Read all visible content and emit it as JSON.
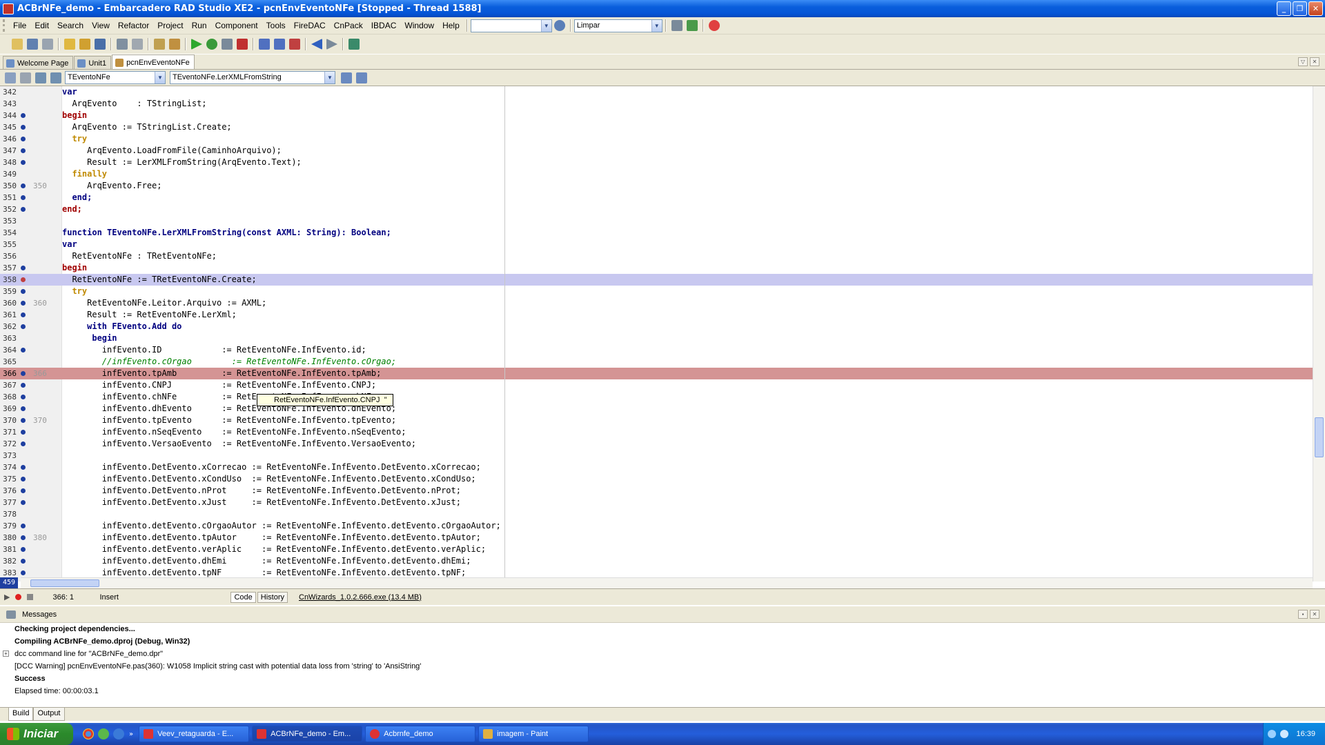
{
  "window": {
    "title": "ACBrNFe_demo - Embarcadero RAD Studio XE2 - pcnEnvEventoNFe [Stopped - Thread 1588]"
  },
  "menu": [
    "File",
    "Edit",
    "Search",
    "View",
    "Refactor",
    "Project",
    "Run",
    "Component",
    "Tools",
    "FireDAC",
    "CnPack",
    "IBDAC",
    "Window",
    "Help"
  ],
  "toolbar": {
    "layout_combo": "",
    "desktop_combo": "Limpar"
  },
  "tabs": [
    "Welcome Page",
    "Unit1",
    "pcnEnvEventoNFe"
  ],
  "navbar": {
    "class_combo": "TEventoNFe",
    "method_combo": "TEventoNFe.LerXMLFromString"
  },
  "editor": {
    "lines": [
      {
        "n": "342",
        "t": "var"
      },
      {
        "n": "343",
        "t": "  ArqEvento    : TStringList;"
      },
      {
        "n": "344",
        "t": "begin"
      },
      {
        "n": "345",
        "t": "  ArqEvento := TStringList.Create;"
      },
      {
        "n": "346",
        "t": "  try"
      },
      {
        "n": "347",
        "t": "     ArqEvento.LoadFromFile(CaminhoArquivo);"
      },
      {
        "n": "348",
        "t": "     Result := LerXMLFromString(ArqEvento.Text);"
      },
      {
        "n": "349",
        "t": "  finally"
      },
      {
        "n": "350",
        "t": "     ArqEvento.Free;"
      },
      {
        "n": "351",
        "t": "  end;"
      },
      {
        "n": "352",
        "t": "end;"
      },
      {
        "n": "353",
        "t": ""
      },
      {
        "n": "354",
        "t": "function TEventoNFe.LerXMLFromString(const AXML: String): Boolean;"
      },
      {
        "n": "355",
        "t": "var"
      },
      {
        "n": "356",
        "t": "  RetEventoNFe : TRetEventoNFe;"
      },
      {
        "n": "357",
        "t": "begin"
      },
      {
        "n": "358",
        "t": "  RetEventoNFe := TRetEventoNFe.Create;"
      },
      {
        "n": "359",
        "t": "  try"
      },
      {
        "n": "360",
        "t": "     RetEventoNFe.Leitor.Arquivo := AXML;"
      },
      {
        "n": "361",
        "t": "     Result := RetEventoNFe.LerXml;"
      },
      {
        "n": "362",
        "t": "     with FEvento.Add do"
      },
      {
        "n": "363",
        "t": "      begin"
      },
      {
        "n": "364",
        "t": "        infEvento.ID            := RetEventoNFe.InfEvento.id;"
      },
      {
        "n": "365",
        "t": "        //infEvento.cOrgao        := RetEventoNFe.InfEvento.cOrgao;"
      },
      {
        "n": "366",
        "t": "        infEvento.tpAmb         := RetEventoNFe.InfEvento.tpAmb;"
      },
      {
        "n": "367",
        "t": "        infEvento.CNPJ          := RetEventoNFe.InfEvento.CNPJ;"
      },
      {
        "n": "368",
        "t": "        infEvento.chNFe         := RetEventoNFe.InfEvento.chNFe;"
      },
      {
        "n": "369",
        "t": "        infEvento.dhEvento      := RetEventoNFe.InfEvento.dhEvento;"
      },
      {
        "n": "370",
        "t": "        infEvento.tpEvento      := RetEventoNFe.InfEvento.tpEvento;"
      },
      {
        "n": "371",
        "t": "        infEvento.nSeqEvento    := RetEventoNFe.InfEvento.nSeqEvento;"
      },
      {
        "n": "372",
        "t": "        infEvento.VersaoEvento  := RetEventoNFe.InfEvento.VersaoEvento;"
      },
      {
        "n": "373",
        "t": ""
      },
      {
        "n": "374",
        "t": "        infEvento.DetEvento.xCorrecao := RetEventoNFe.InfEvento.DetEvento.xCorrecao;"
      },
      {
        "n": "375",
        "t": "        infEvento.DetEvento.xCondUso  := RetEventoNFe.InfEvento.DetEvento.xCondUso;"
      },
      {
        "n": "376",
        "t": "        infEvento.DetEvento.nProt     := RetEventoNFe.InfEvento.DetEvento.nProt;"
      },
      {
        "n": "377",
        "t": "        infEvento.DetEvento.xJust     := RetEventoNFe.InfEvento.DetEvento.xJust;"
      },
      {
        "n": "378",
        "t": ""
      },
      {
        "n": "379",
        "t": "        infEvento.detEvento.cOrgaoAutor := RetEventoNFe.InfEvento.detEvento.cOrgaoAutor;"
      },
      {
        "n": "380",
        "t": "        infEvento.detEvento.tpAutor     := RetEventoNFe.InfEvento.detEvento.tpAutor;"
      },
      {
        "n": "381",
        "t": "        infEvento.detEvento.verAplic    := RetEventoNFe.InfEvento.detEvento.verAplic;"
      },
      {
        "n": "382",
        "t": "        infEvento.detEvento.dhEmi       := RetEventoNFe.InfEvento.detEvento.dhEmi;"
      },
      {
        "n": "383",
        "t": "        infEvento.detEvento.tpNF        := RetEventoNFe.InfEvento.detEvento.tpNF;"
      }
    ],
    "tooltip": "RetEventoNFe.InfEvento.CNPJ  ''",
    "line_count_label": "459"
  },
  "status": {
    "position": "366:  1",
    "mode": "Insert",
    "tab_code": "Code",
    "tab_history": "History",
    "cnwizards": "CnWizards_1.0.2.666.exe (13.4 MB)"
  },
  "messages": {
    "title": "Messages",
    "lines": [
      "Checking project dependencies...",
      "Compiling ACBrNFe_demo.dproj (Debug, Win32)",
      "dcc command line for \"ACBrNFe_demo.dpr\"",
      "[DCC Warning] pcnEnvEventoNFe.pas(360): W1058 Implicit string cast with potential data loss from 'string' to 'AnsiString'",
      "Success",
      "Elapsed time: 00:00:03.1"
    ],
    "tab_build": "Build",
    "tab_output": "Output"
  },
  "taskbar": {
    "start": "Iniciar",
    "buttons": [
      "Veev_retaguarda - E...",
      "ACBrNFe_demo - Em...",
      "Acbrnfe_demo",
      "imagem - Paint"
    ],
    "clock": "16:39"
  }
}
